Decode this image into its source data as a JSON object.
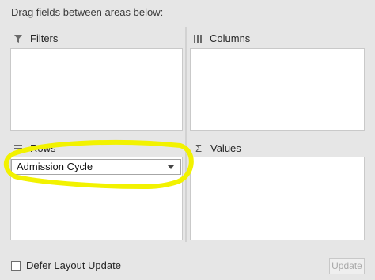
{
  "instruction": "Drag fields between areas below:",
  "areas": {
    "filters": {
      "label": "Filters",
      "icon": "filter-icon"
    },
    "columns": {
      "label": "Columns",
      "icon": "columns-icon"
    },
    "rows": {
      "label": "Rows",
      "icon": "rows-icon",
      "fields": [
        "Admission Cycle"
      ]
    },
    "values": {
      "label": "Values",
      "icon": "sigma-icon"
    }
  },
  "footer": {
    "defer_label": "Defer Layout Update",
    "defer_checked": false,
    "update_label": "Update",
    "update_enabled": false
  },
  "annotation": {
    "color": "#f2f200"
  }
}
